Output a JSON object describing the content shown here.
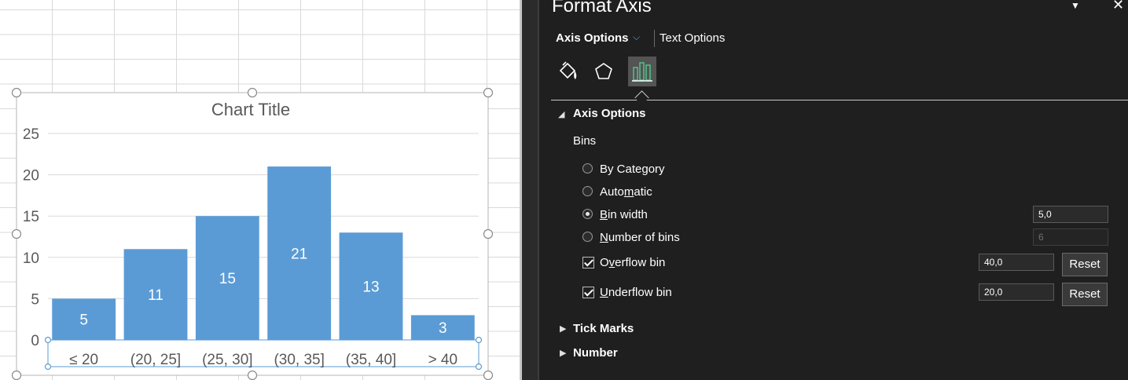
{
  "pane": {
    "title": "Format Axis",
    "menu_icon": "chevron-down-icon",
    "close_icon": "close-icon",
    "tabs": [
      {
        "label": "Axis Options",
        "active": true
      },
      {
        "label": "Text Options",
        "active": false
      }
    ],
    "categories": [
      "fill-line-icon",
      "effects-icon",
      "axis-options-icon"
    ],
    "sections": {
      "axis_options": {
        "label": "Axis Options",
        "expanded": true,
        "bins_label": "Bins",
        "options": [
          {
            "label": "By Category",
            "selected": false
          },
          {
            "label": "Automatic",
            "selected": false
          },
          {
            "label": "Bin width",
            "selected": true,
            "value": "5,0"
          },
          {
            "label": "Number of bins",
            "selected": false,
            "value": "6",
            "disabled": true
          }
        ],
        "overflow": {
          "label": "Overflow bin",
          "checked": true,
          "value": "40,0",
          "reset": "Reset"
        },
        "underflow": {
          "label": "Underflow bin",
          "checked": true,
          "value": "20,0",
          "reset": "Reset"
        }
      },
      "tick_marks": {
        "label": "Tick Marks",
        "expanded": false
      },
      "number": {
        "label": "Number",
        "expanded": false
      }
    },
    "accent_color": "#62a3e6"
  },
  "chart_data": {
    "type": "bar",
    "title": "Chart Title",
    "categories": [
      "≤ 20",
      "(20, 25]",
      "(25, 30]",
      "(30, 35]",
      "(35, 40]",
      "> 40"
    ],
    "values": [
      5,
      11,
      15,
      21,
      13,
      3
    ],
    "data_labels": [
      "5",
      "11",
      "15",
      "21",
      "13",
      "3"
    ],
    "yticks": [
      "0",
      "5",
      "10",
      "15",
      "20",
      "25"
    ],
    "ylim": [
      0,
      25
    ],
    "grid": true,
    "bar_color": "#5b9bd5",
    "xlabel": "",
    "ylabel": ""
  }
}
